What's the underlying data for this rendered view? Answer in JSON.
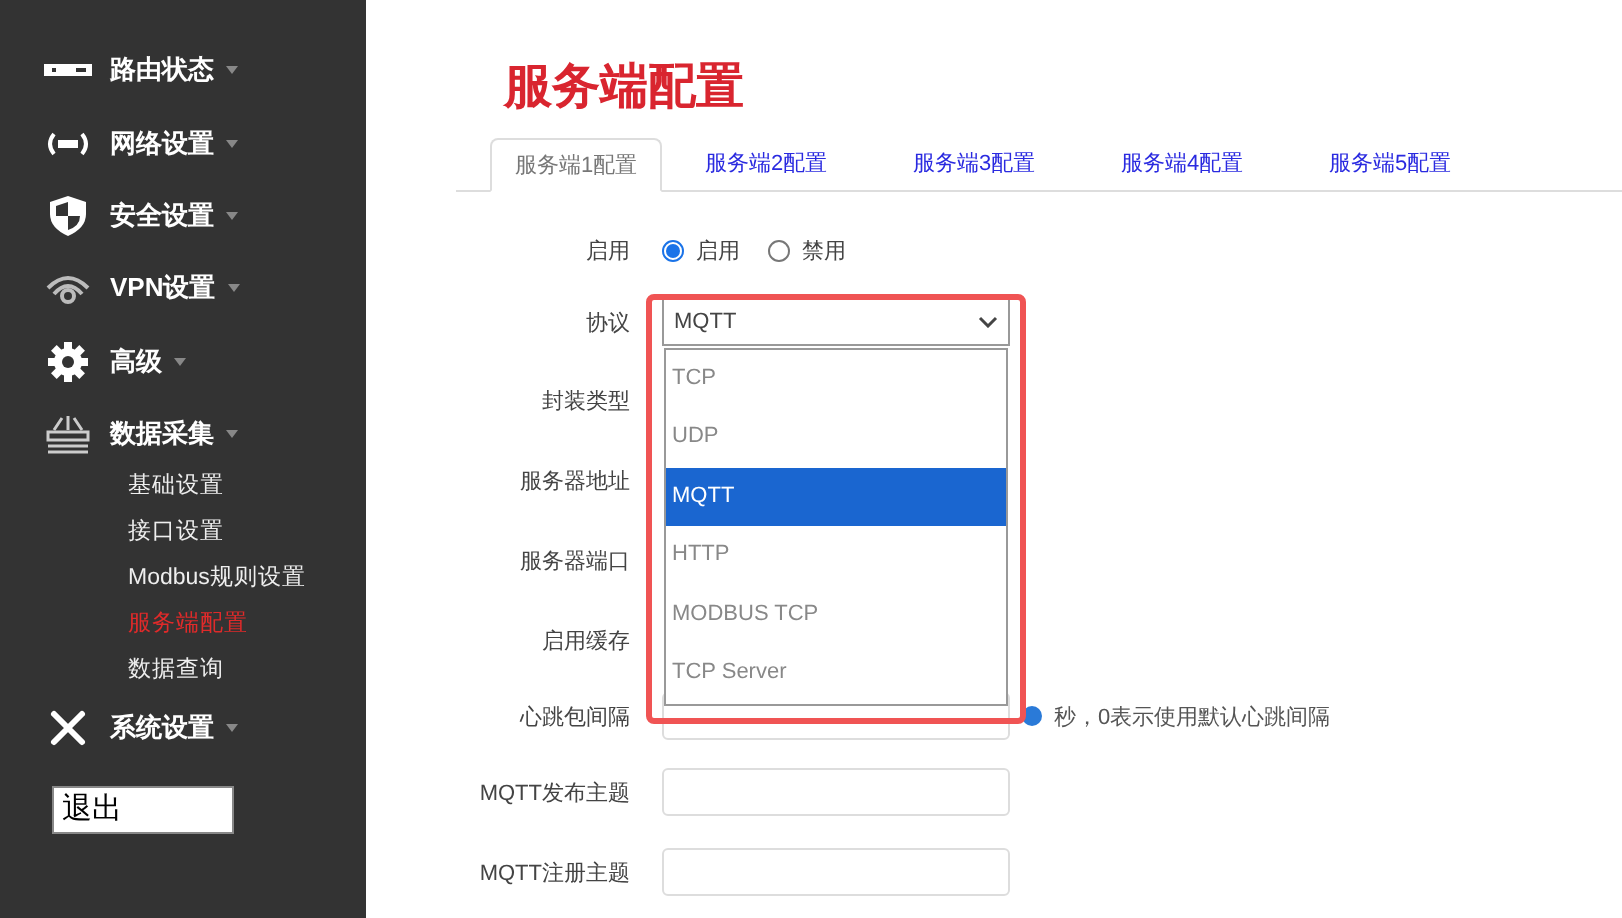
{
  "sidebar": {
    "items": [
      {
        "label": "路由状态"
      },
      {
        "label": "网络设置"
      },
      {
        "label": "安全设置"
      },
      {
        "label": "VPN设置"
      },
      {
        "label": "高级"
      },
      {
        "label": "数据采集",
        "children": [
          {
            "label": "基础设置",
            "selected": false
          },
          {
            "label": "接口设置",
            "selected": false
          },
          {
            "label": "Modbus规则设置",
            "selected": false
          },
          {
            "label": "服务端配置",
            "selected": true
          },
          {
            "label": "数据查询",
            "selected": false
          }
        ]
      },
      {
        "label": "系统设置"
      }
    ],
    "logout_button": "退出"
  },
  "page_title": "服务端配置",
  "tabs": [
    {
      "label": "服务端1配置",
      "selected": true
    },
    {
      "label": "服务端2配置",
      "selected": false
    },
    {
      "label": "服务端3配置",
      "selected": false
    },
    {
      "label": "服务端4配置",
      "selected": false
    },
    {
      "label": "服务端5配置",
      "selected": false
    }
  ],
  "form": {
    "rows": [
      {
        "label": "启用",
        "kind": "radio",
        "options": [
          {
            "label": "启用",
            "selected": true
          },
          {
            "label": "禁用",
            "selected": false
          }
        ]
      },
      {
        "label": "协议",
        "kind": "select",
        "value": "MQTT",
        "open": true,
        "highlighted": true,
        "options": [
          {
            "label": "TCP",
            "selected": false
          },
          {
            "label": "UDP",
            "selected": false
          },
          {
            "label": "MQTT",
            "selected": true
          },
          {
            "label": "HTTP",
            "selected": false
          },
          {
            "label": "MODBUS TCP",
            "selected": false
          },
          {
            "label": "TCP Server",
            "selected": false
          }
        ]
      },
      {
        "label": "封装类型",
        "kind": "covered"
      },
      {
        "label": "服务器地址",
        "kind": "covered"
      },
      {
        "label": "服务器端口",
        "kind": "covered"
      },
      {
        "label": "启用缓存",
        "kind": "covered"
      },
      {
        "label": "心跳包间隔",
        "kind": "text",
        "hint": "秒，0表示使用默认心跳间隔"
      },
      {
        "label": "MQTT发布主题",
        "kind": "text"
      },
      {
        "label": "MQTT注册主题",
        "kind": "text"
      }
    ]
  }
}
